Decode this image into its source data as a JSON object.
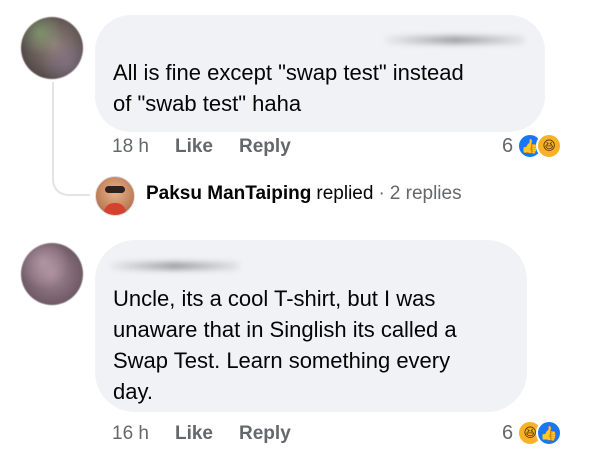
{
  "comments": [
    {
      "text": "All is fine except \"swap test\" instead\nof \"swab test\" haha",
      "time": "18 h",
      "like_label": "Like",
      "reply_label": "Reply",
      "reaction_count": "6",
      "reactions": [
        "like-icon",
        "haha-icon"
      ]
    },
    {
      "text": "Uncle, its a cool T-shirt, but I was\nunaware that in Singlish its called a\nSwap Test. Learn something every\nday.",
      "time": "16 h",
      "like_label": "Like",
      "reply_label": "Reply",
      "reaction_count": "6",
      "reactions": [
        "haha-icon",
        "like-icon"
      ]
    }
  ],
  "replies": {
    "replier_name": "Paksu ManTaiping",
    "replied_label": "replied",
    "separator": "·",
    "count_label": "2 replies"
  },
  "colors": {
    "bubble": "#f0f2f5",
    "meta_text": "#65676b",
    "like_blue": "#1877f2",
    "haha_yellow": "#f7b125"
  }
}
